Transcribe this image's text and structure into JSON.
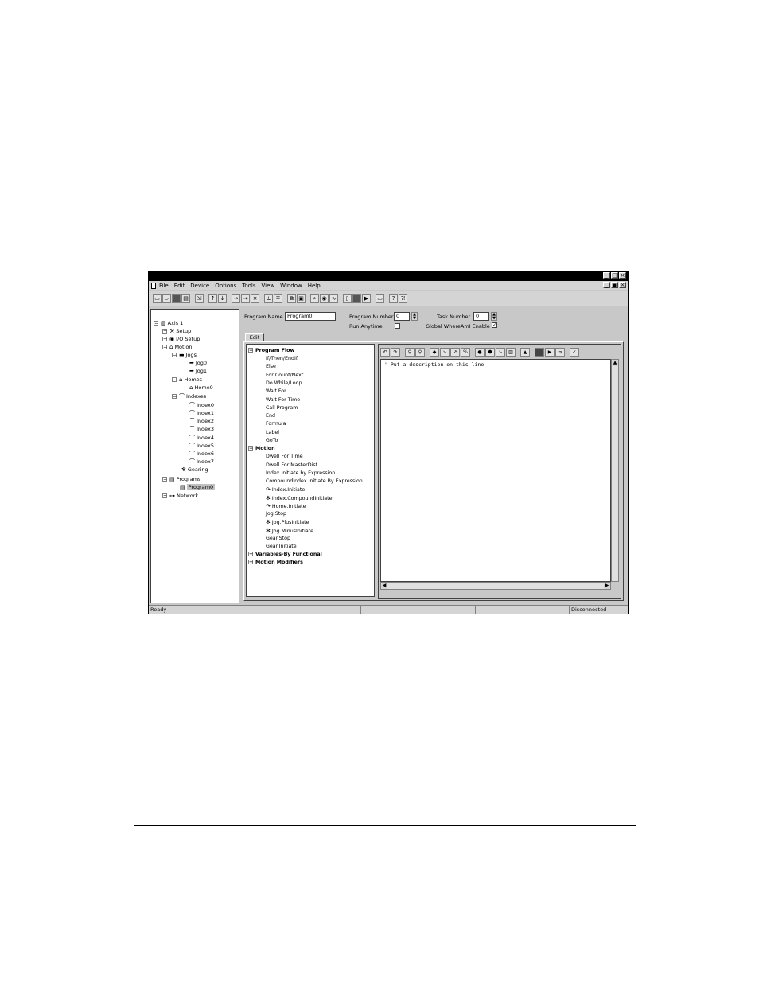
{
  "window": {
    "title_buttons": [
      "_",
      "□",
      "×"
    ],
    "mdi_buttons": [
      "_",
      "▣",
      "×"
    ]
  },
  "menu": {
    "items": [
      "File",
      "Edit",
      "Device",
      "Options",
      "Tools",
      "View",
      "Window",
      "Help"
    ]
  },
  "toolbar": {
    "icons": [
      "new-icon",
      "open-icon",
      "save-icon",
      "print-icon",
      "import-icon",
      "upload-icon",
      "download-icon",
      "ins-icon",
      "del-icon",
      "cut-icon",
      "paste-icon",
      "find-icon",
      "zoom-icon",
      "run-icon",
      "stop-icon",
      "config-icon",
      "help-icon",
      "context-help-icon"
    ]
  },
  "tree": {
    "root": "Axis 1",
    "setup": "Setup",
    "io_setup": "I/O Setup",
    "motion": "Motion",
    "jogs": "Jogs",
    "jog0": "Jog0",
    "jog1": "Jog1",
    "homes": "Homes",
    "home0": "Home0",
    "indexes": "Indexes",
    "index_items": [
      "Index0",
      "Index1",
      "Index2",
      "Index3",
      "Index4",
      "Index5",
      "Index6",
      "Index7"
    ],
    "gearing": "Gearing",
    "programs": "Programs",
    "program0": "Program0",
    "network": "Network"
  },
  "program_form": {
    "program_name_label": "Program Name",
    "program_name_value": "Program0",
    "program_number_label": "Program Number",
    "program_number_value": "0",
    "task_number_label": "Task Number",
    "task_number_value": "0",
    "run_anytime_label": "Run Anytime",
    "run_anytime_checked": false,
    "global_whereami_label": "Global WhereAmI Enable",
    "global_whereami_checked": true,
    "tab_label": "Edit"
  },
  "commands": {
    "program_flow": "Program Flow",
    "program_flow_items": [
      "If/Then/EndIf",
      "Else",
      "For Count/Next",
      "Do While/Loop",
      "Wait For",
      "Wait For Time",
      "Call Program",
      "End",
      "Formula",
      "Label",
      "GoTo"
    ],
    "motion": "Motion",
    "motion_items": [
      "Dwell For Time",
      "Dwell For MasterDist",
      "Index.Initiate by Expression",
      "CompoundIndex.Initiate By Expression",
      "Index.Initiate",
      "Index.CompoundInitiate",
      "Home.Initiate",
      "Jog.Stop",
      "Jog.PlusInitiate",
      "Jog.MinusInitiate",
      "Gear.Stop",
      "Gear.Initiate"
    ],
    "variables": "Variables-By Functional",
    "modifiers": "Motion Modifiers"
  },
  "editor": {
    "line1": "' Put a description on this line"
  },
  "status": {
    "ready": "Ready",
    "connection": "Disconnected"
  }
}
